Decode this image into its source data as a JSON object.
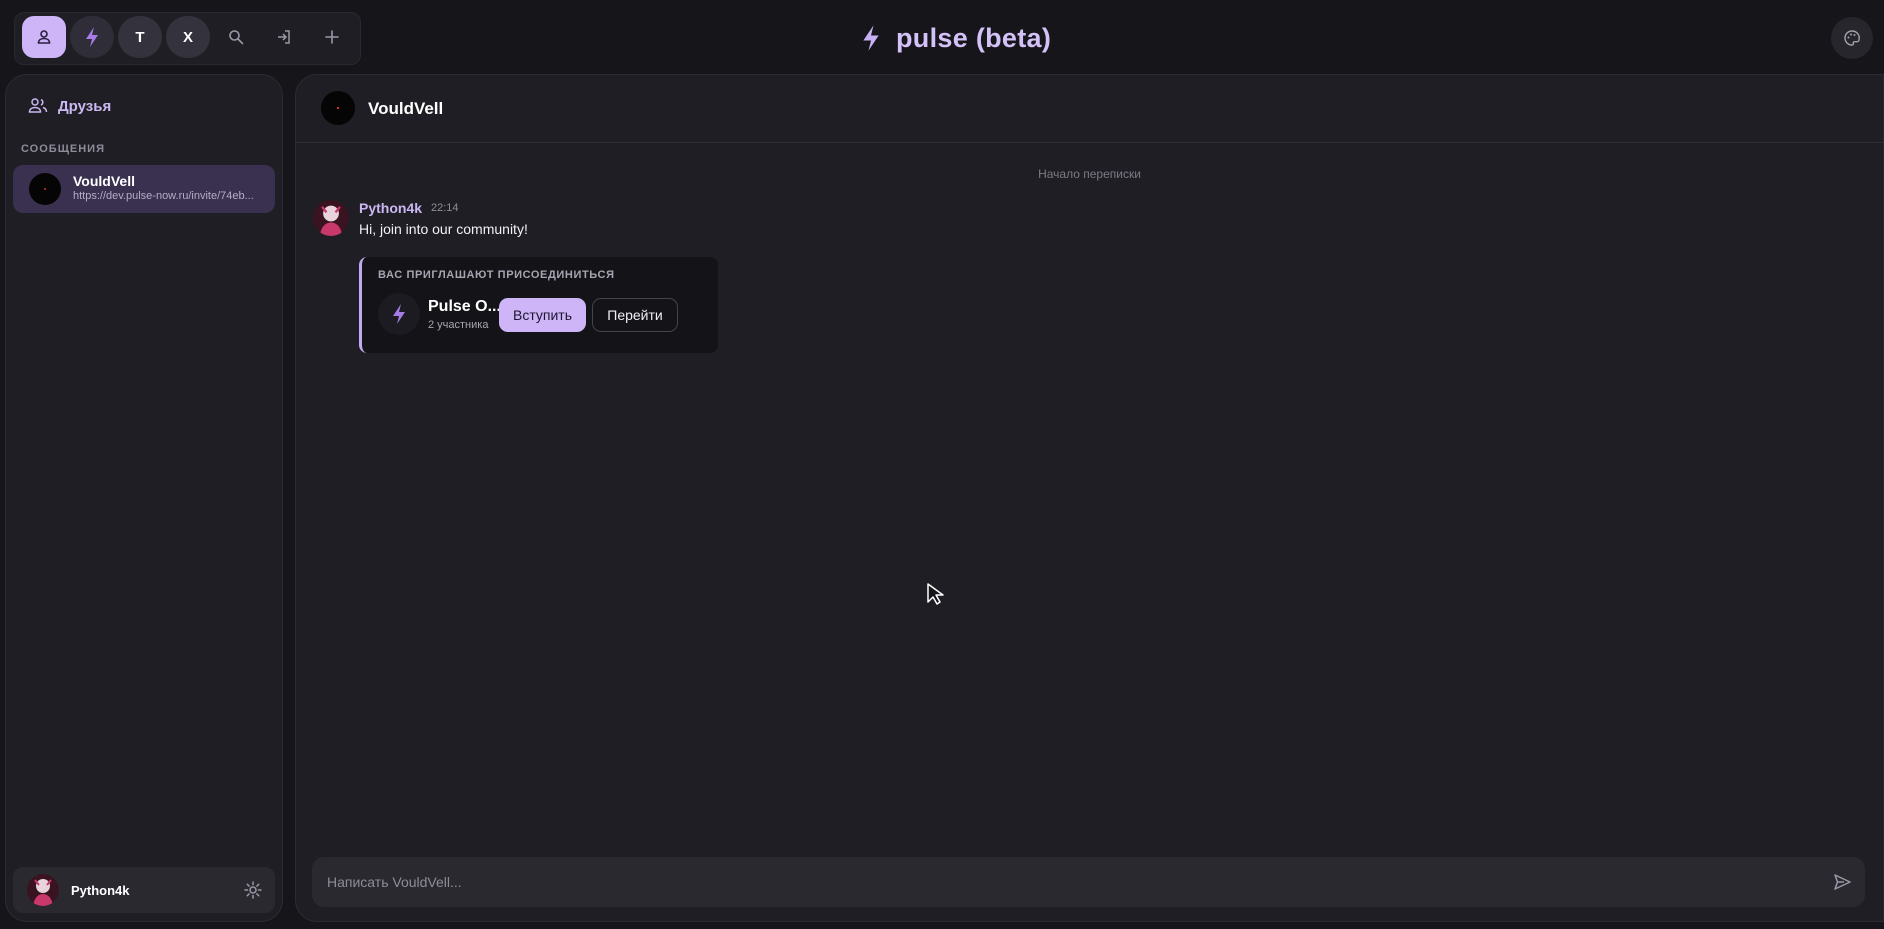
{
  "app": {
    "title": "pulse (beta)"
  },
  "server_bar": {
    "items": [
      {
        "icon": "user-icon",
        "active": true
      },
      {
        "icon": "bolt-icon"
      },
      {
        "label": "T"
      },
      {
        "label": "X"
      },
      {
        "icon": "search-icon"
      },
      {
        "icon": "login-icon"
      },
      {
        "icon": "plus-icon"
      }
    ]
  },
  "sidebar": {
    "friends_label": "Друзья",
    "section_label": "СООБЩЕНИЯ",
    "dm_items": [
      {
        "name": "VouldVell",
        "preview": "https://dev.pulse-now.ru/invite/74eb...",
        "active": true
      }
    ]
  },
  "user_panel": {
    "name": "Python4k"
  },
  "chat": {
    "header_name": "VouldVell",
    "start_label": "Начало переписки",
    "messages": [
      {
        "author": "Python4k",
        "time": "22:14",
        "text": "Hi, join into our community!",
        "invite": {
          "title": "ВАС ПРИГЛАШАЮТ ПРИСОЕДИНИТЬСЯ",
          "server_name": "Pulse O...",
          "member_count": "2 участника",
          "join_label": "Вступить",
          "goto_label": "Перейти"
        }
      }
    ],
    "composer": {
      "placeholder": "Написать VouldVell..."
    }
  },
  "colors": {
    "background": "#161519",
    "panel": "#1f1e24",
    "accent": "#cdb5f7",
    "active_dm": "#3a3050"
  }
}
